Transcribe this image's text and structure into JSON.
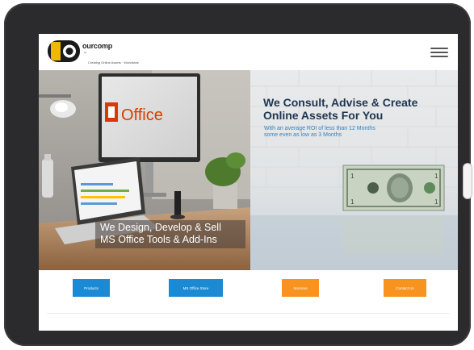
{
  "header": {
    "brand": "ourcomp",
    "brand_sub": "ltd",
    "tagline": "Creating Online Assets · Worldwide",
    "menu_icon": "hamburger-icon"
  },
  "hero": {
    "left": {
      "caption_line1": "We Design, Develop & Sell",
      "caption_line2": "MS Office Tools & Add-Ins",
      "monitor_logo_text": "Office"
    },
    "right": {
      "title_line1": "We Consult, Advise & Create",
      "title_line2": "Online Assets For You",
      "subtitle_line1": "With an average ROI of less than 12 Months",
      "subtitle_line2": "some even as low as 3 Months"
    }
  },
  "cta_buttons": [
    {
      "label": "Products",
      "color": "#1a8ad4"
    },
    {
      "label": "MS Office Store",
      "color": "#1a8ad4"
    },
    {
      "label": "Services",
      "color": "#f7931e"
    },
    {
      "label": "Contact Us",
      "color": "#f7931e"
    }
  ],
  "colors": {
    "tablet_frame": "#2b2b2d",
    "title_navy": "#1d3550",
    "subtitle_blue": "#2a84c9",
    "office_orange": "#d83b01"
  }
}
